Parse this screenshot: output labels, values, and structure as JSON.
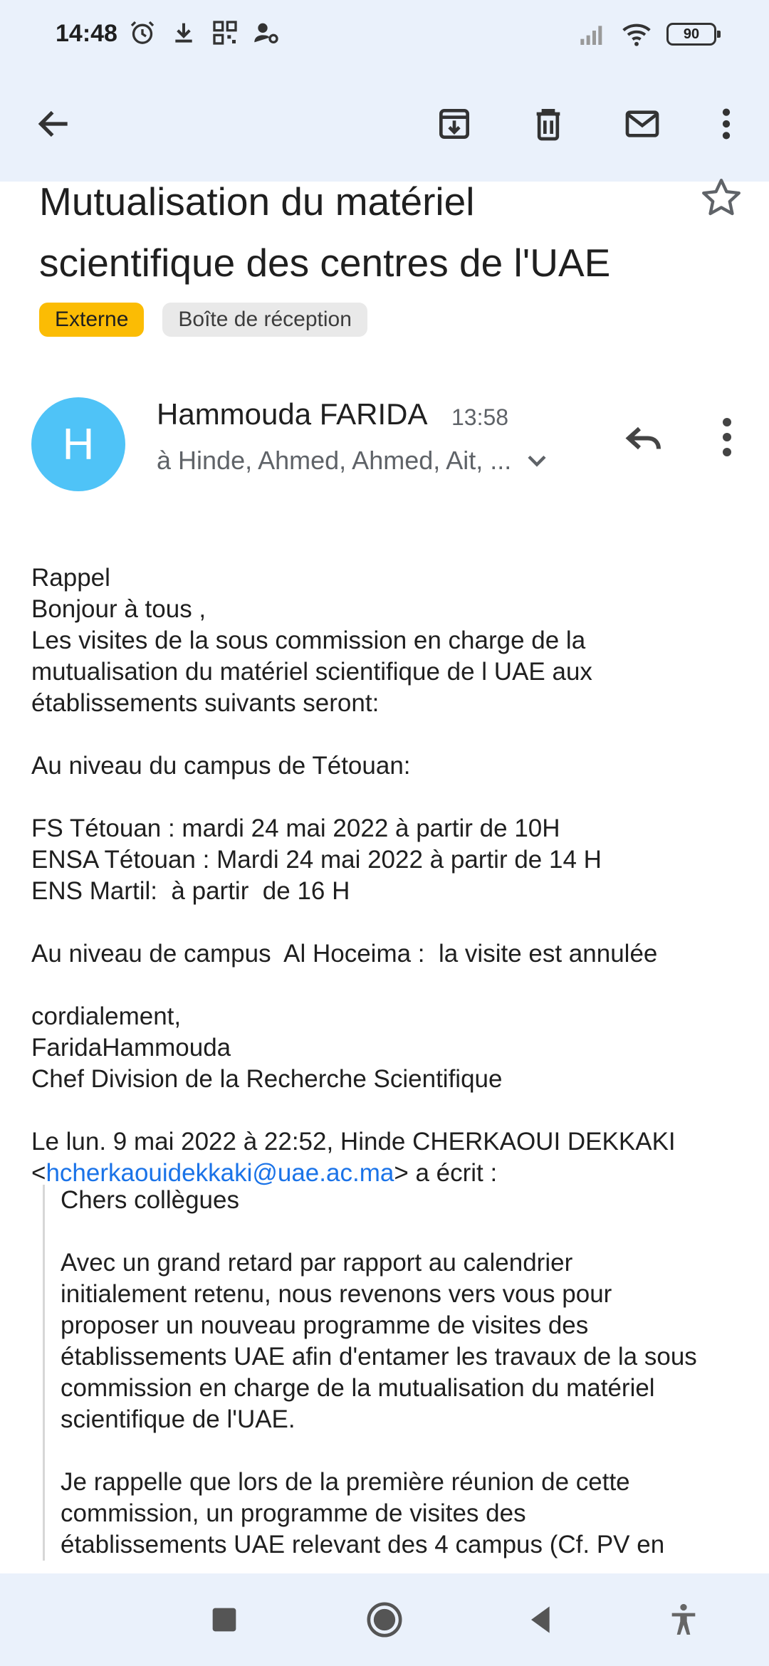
{
  "status_bar": {
    "time": "14:48",
    "battery": "90",
    "icons": [
      "alarm-icon",
      "download-icon",
      "qr-icon",
      "user-settings-icon",
      "signal-icon",
      "wifi-icon",
      "battery-icon"
    ]
  },
  "toolbar": {
    "back": "back-arrow-icon",
    "archive": "archive-icon",
    "delete": "trash-icon",
    "mark_unread": "mail-icon",
    "more": "more-vert-icon"
  },
  "email": {
    "subject_line1": "Mutualisation du matériel",
    "subject_line2": "scientifique des centres de l'UAE",
    "labels": [
      "Externe",
      "Boîte de réception"
    ],
    "sender": {
      "initial": "H",
      "name": "Hammouda FARIDA",
      "time": "13:58",
      "recipients": "à Hinde, Ahmed, Ahmed, Ait, ..."
    },
    "body": [
      "Rappel",
      "Bonjour à tous ,",
      "Les visites de la sous commission en charge de la",
      "mutualisation du matériel scientifique de l UAE aux",
      "établissements suivants seront:",
      "",
      "Au niveau du campus de Tétouan:",
      "",
      "FS Tétouan : mardi 24 mai 2022 à partir de 10H",
      "ENSA Tétouan : Mardi 24 mai 2022 à partir de 14 H",
      "ENS Martil:  à partir  de 16 H",
      "",
      "Au niveau de campus  Al Hoceima :  la visite est annulée",
      "",
      "cordialement,",
      "FaridaHammouda",
      "Chef Division de la Recherche Scientifique",
      "",
      "Le lun. 9 mai 2022 à 22:52, Hinde CHERKAOUI DEKKAKI"
    ],
    "wrote_prefix": "<",
    "wrote_email": "hcherkaouidekkaki@uae.ac.ma",
    "wrote_suffix": "> a écrit :",
    "quote": [
      "Chers collègues",
      "",
      "Avec un grand retard par rapport au calendrier",
      "initialement retenu, nous revenons vers vous pour",
      "proposer un nouveau programme de visites des",
      "établissements UAE afin d'entamer les travaux de la sous",
      "commission en charge de la mutualisation du matériel",
      "scientifique de l'UAE.",
      "",
      "Je rappelle que lors de la première réunion de cette",
      "commission, un programme de visites des",
      "établissements UAE relevant des 4 campus (Cf. PV en"
    ]
  },
  "navbar": {
    "recents": "square-icon",
    "home": "home-circle-icon",
    "back": "back-triangle-icon",
    "accessibility": "accessibility-icon"
  }
}
